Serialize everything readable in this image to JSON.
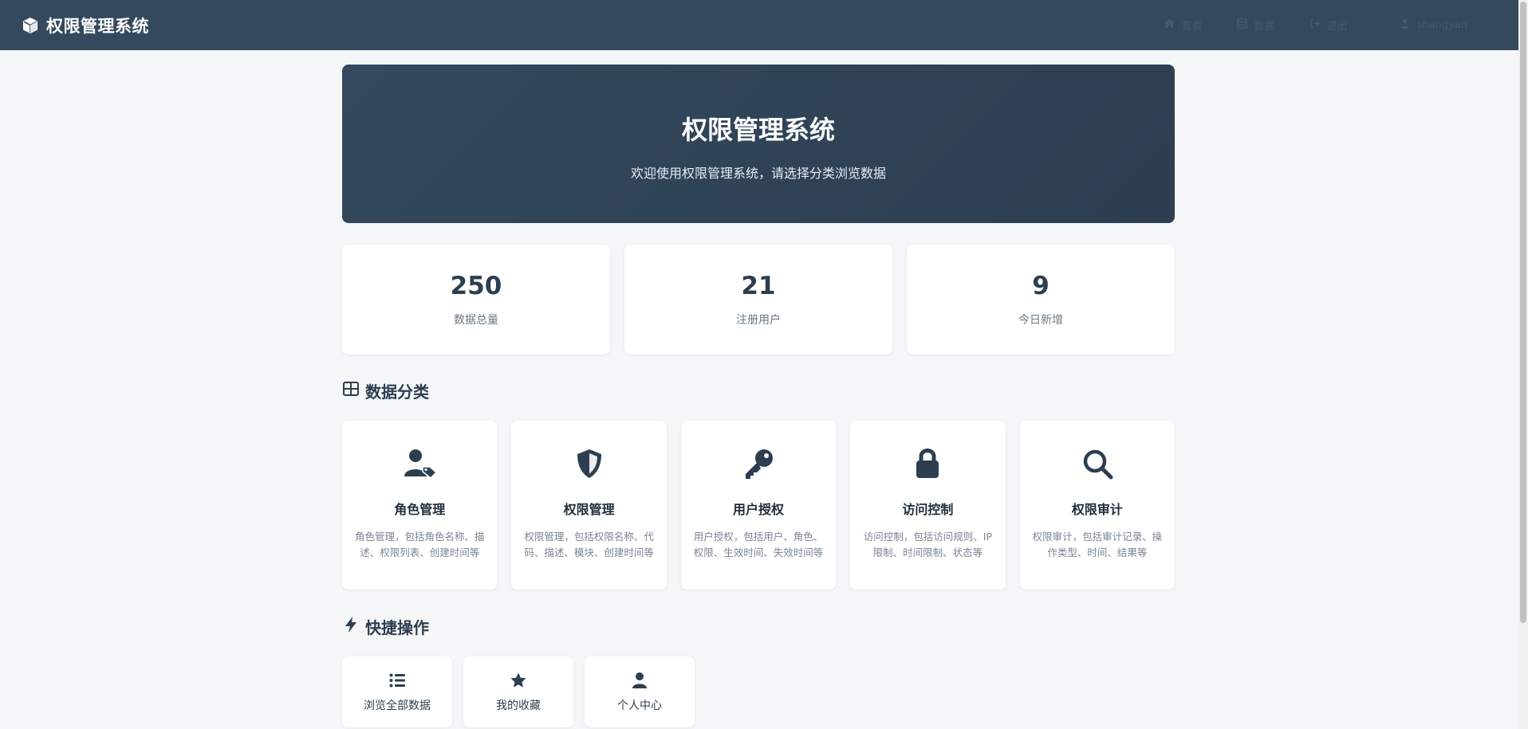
{
  "navbar": {
    "brand": "权限管理系统",
    "links": [
      {
        "label": "首页",
        "icon": "home-icon"
      },
      {
        "label": "数据",
        "icon": "database-icon"
      },
      {
        "label": "退出",
        "icon": "logout-icon"
      },
      {
        "label": "shangyan",
        "icon": "user-icon"
      }
    ]
  },
  "hero": {
    "title": "权限管理系统",
    "subtitle": "欢迎使用权限管理系统，请选择分类浏览数据"
  },
  "stats": [
    {
      "value": "250",
      "label": "数据总量"
    },
    {
      "value": "21",
      "label": "注册用户"
    },
    {
      "value": "9",
      "label": "今日新增"
    }
  ],
  "categories_section": {
    "title": "数据分类",
    "items": [
      {
        "title": "角色管理",
        "desc": "角色管理，包括角色名称、描述、权限列表、创建时间等",
        "icon": "user-tag-icon"
      },
      {
        "title": "权限管理",
        "desc": "权限管理，包括权限名称、代码、描述、模块、创建时间等",
        "icon": "shield-icon"
      },
      {
        "title": "用户授权",
        "desc": "用户授权，包括用户、角色、权限、生效时间、失效时间等",
        "icon": "key-icon"
      },
      {
        "title": "访问控制",
        "desc": "访问控制，包括访问规则、IP限制、时间限制、状态等",
        "icon": "lock-icon"
      },
      {
        "title": "权限审计",
        "desc": "权限审计，包括审计记录、操作类型、时间、结果等",
        "icon": "search-icon"
      }
    ]
  },
  "quick_section": {
    "title": "快捷操作",
    "items": [
      {
        "label": "浏览全部数据",
        "icon": "list-icon"
      },
      {
        "label": "我的收藏",
        "icon": "star-icon"
      },
      {
        "label": "个人中心",
        "icon": "user-icon"
      }
    ]
  },
  "colors": {
    "navbar": "#34495e",
    "primary": "#2c3e50",
    "background": "#f5f6f8",
    "card": "#ffffff",
    "muted": "#7a8591"
  }
}
